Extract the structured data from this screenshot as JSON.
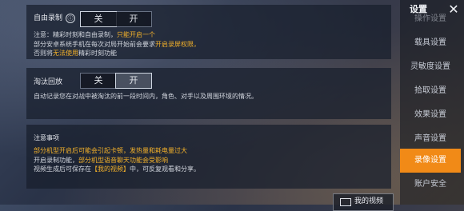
{
  "free_record": {
    "label": "自由录制",
    "info_icon": "ⓘ",
    "off": "关",
    "on": "开",
    "note_line1_a": "注意：精彩时刻和自由录制，",
    "note_line1_b": "只能开启一个",
    "note_line2_a": "部分安卓系统手机在每次对局开始前会要求",
    "note_line2_b": "开启录屏权限，",
    "note_line3_a": "否则将",
    "note_line3_b": "无法使用",
    "note_line3_c": "精彩时刻功能"
  },
  "elimination_replay": {
    "label": "淘汰回放",
    "off": "关",
    "on": "开",
    "desc": "自动记录您在对战中被淘汰的前一段时间内，角色、对手以及周围环境的情况。"
  },
  "notice": {
    "title": "注意事项",
    "line1": "部分机型开启后可能会引起卡顿，发热量和耗电量过大",
    "line2_a": "开启录制功能，",
    "line2_b": "部分机型语音聊天功能会受影响",
    "line3_a": "视频生成后可保存在",
    "line3_b": "【我的视频】",
    "line3_c": "中，可反复观看和分享。"
  },
  "my_video_button": {
    "label": "我的视频",
    "icon": "video-camera-icon"
  },
  "sidebar": {
    "title": "设置",
    "items": [
      "操作设置",
      "载具设置",
      "灵敏度设置",
      "拾取设置",
      "效果设置",
      "声音设置",
      "录像设置",
      "账户安全"
    ],
    "active_index": 6
  },
  "colors": {
    "accent": "#f18a17",
    "highlight": "#f3b12a"
  }
}
